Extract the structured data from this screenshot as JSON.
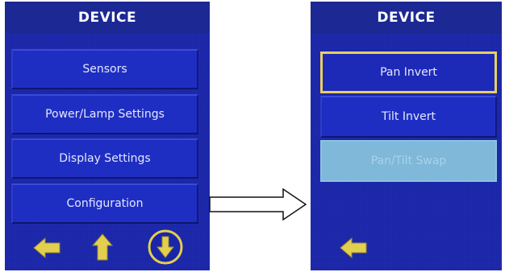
{
  "left_screen": {
    "title": "DEVICE",
    "items": [
      {
        "label": "Sensors"
      },
      {
        "label": "Power/Lamp Settings"
      },
      {
        "label": "Display Settings"
      },
      {
        "label": "Configuration"
      }
    ],
    "nav_icons": [
      "arrow-left-icon",
      "arrow-up-icon",
      "arrow-down-circle-icon"
    ]
  },
  "right_screen": {
    "title": "DEVICE",
    "items": [
      {
        "label": "Pan Invert",
        "state": "selected"
      },
      {
        "label": "Tilt Invert",
        "state": "normal"
      },
      {
        "label": "Pan/Tilt Swap",
        "state": "disabled"
      }
    ],
    "nav_icons": [
      "arrow-left-icon"
    ]
  },
  "colors": {
    "screen_bg": "#1a25a8",
    "button_bg": "#1f2ec2",
    "highlight": "#e8d060",
    "icon_yellow": "#e3cf4f",
    "disabled_bg": "#7fb8d8"
  }
}
